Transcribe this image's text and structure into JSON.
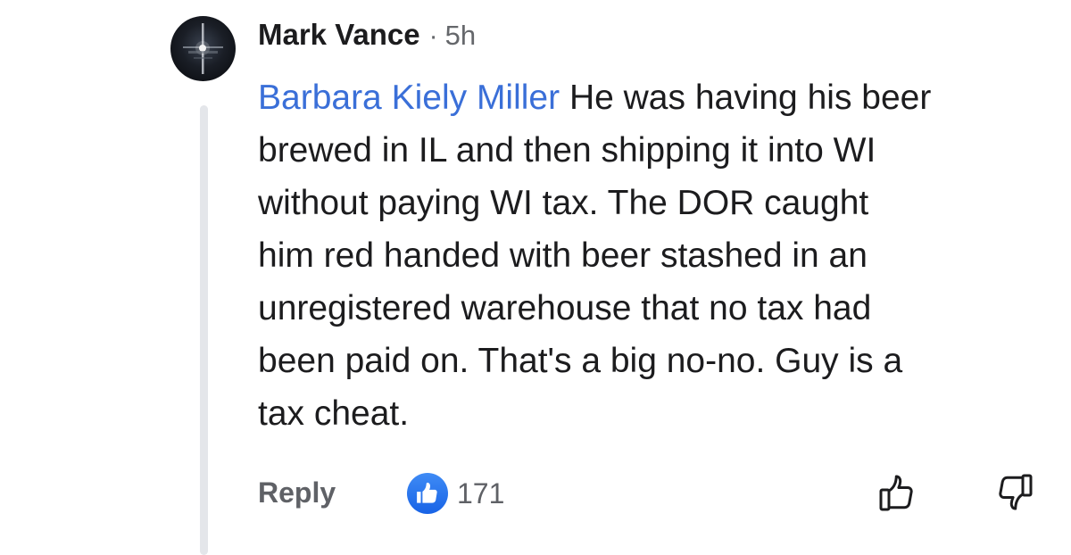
{
  "comment": {
    "author": "Mark Vance",
    "separator": "·",
    "time": "5h",
    "mention": "Barbara Kiely Miller",
    "text": " He was having his beer\nbrewed in IL and then shipping it into WI\nwithout paying WI tax. The DOR caught\nhim red handed with beer stashed in an\nunregistered warehouse  that no tax had\nbeen paid on. That's a big no-no. Guy is a\ntax cheat."
  },
  "actions": {
    "reply_label": "Reply",
    "reaction_count": "171"
  },
  "icons": {
    "avatar": "avatar-image",
    "reaction": "thumbs-up-reaction-icon",
    "upvote": "thumbs-up-outline-icon",
    "downvote": "thumbs-down-outline-icon"
  },
  "colors": {
    "mention": "#3a6fd8",
    "like_badge": "#1877f2",
    "muted_text": "#65676b",
    "thread_line": "#e4e6ea"
  }
}
